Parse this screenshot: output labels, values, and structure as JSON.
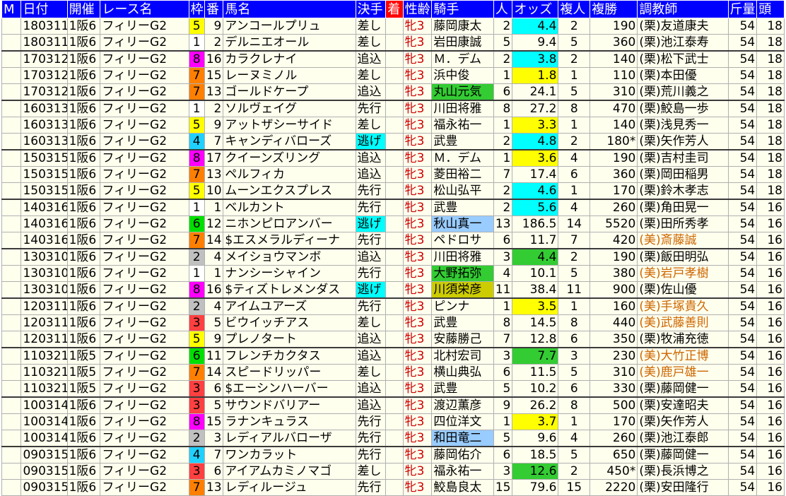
{
  "header": [
    "M",
    "日付",
    "開催",
    "レース名",
    "枠",
    "番",
    "馬名",
    "決手",
    "着",
    "性齢",
    "騎手",
    "人",
    "オッズ",
    "複人",
    "複勝",
    "調教師",
    "斤量",
    "頭"
  ],
  "colors": {
    "frame": {
      "1": "#ffffff",
      "2": "#c0c0c0",
      "3": "#ff4040",
      "4": "#20d0ff",
      "5": "#ffff00",
      "6": "#00e000",
      "7": "#ff8000",
      "8": "#ff00ff"
    },
    "odds_hl": {
      "y": "#ffff00",
      "c": "#00ffff",
      "g": "#33cc33"
    }
  },
  "rows": [
    {
      "date": "180311",
      "kaisai": "1阪6",
      "race": "フィリーG2",
      "waku": "5",
      "ban": "9",
      "horse": "アンコールプリュ",
      "kimete": "差し",
      "chaku": "",
      "sexage": "牝3",
      "jockey": "藤岡康太",
      "jhl": "",
      "ninki": "2",
      "odds": "4.4",
      "ohl": "c",
      "fninki": "2",
      "fuku": "190",
      "mark": "",
      "trainer": "(栗)友道康夫",
      "tm": "",
      "kinryo": "54",
      "tou": "18",
      "grp": false
    },
    {
      "date": "180311",
      "kaisai": "1阪6",
      "race": "フィリーG2",
      "waku": "1",
      "ban": "2",
      "horse": "デルニエオール",
      "kimete": "差し",
      "chaku": "",
      "sexage": "牝3",
      "jockey": "岩田康誠",
      "jhl": "",
      "ninki": "5",
      "odds": "9.4",
      "ohl": "",
      "fninki": "5",
      "fuku": "360",
      "mark": "",
      "trainer": "(栗)池江泰寿",
      "tm": "",
      "kinryo": "54",
      "tou": "18",
      "grp": false
    },
    {
      "date": "170312",
      "kaisai": "1阪6",
      "race": "フィリーG2",
      "waku": "8",
      "ban": "16",
      "horse": "カラクレナイ",
      "kimete": "追込",
      "chaku": "",
      "sexage": "牝3",
      "jockey": "Ｍ．デム",
      "jhl": "",
      "ninki": "2",
      "odds": "3.8",
      "ohl": "c",
      "fninki": "2",
      "fuku": "140",
      "mark": "",
      "trainer": "(栗)松下武士",
      "tm": "",
      "kinryo": "54",
      "tou": "18",
      "grp": true
    },
    {
      "date": "170312",
      "kaisai": "1阪6",
      "race": "フィリーG2",
      "waku": "7",
      "ban": "15",
      "horse": "レーヌミノル",
      "kimete": "差し",
      "chaku": "",
      "sexage": "牝3",
      "jockey": "浜中俊",
      "jhl": "",
      "ninki": "1",
      "odds": "1.8",
      "ohl": "y",
      "fninki": "1",
      "fuku": "110",
      "mark": "",
      "trainer": "(栗)本田優",
      "tm": "",
      "kinryo": "54",
      "tou": "18",
      "grp": false
    },
    {
      "date": "170312",
      "kaisai": "1阪6",
      "race": "フィリーG2",
      "waku": "7",
      "ban": "13",
      "horse": "ゴールドケープ",
      "kimete": "追込",
      "chaku": "",
      "sexage": "牝3",
      "jockey": "丸山元気",
      "jhl": "gr",
      "ninki": "6",
      "odds": "24.1",
      "ohl": "",
      "fninki": "5",
      "fuku": "310",
      "mark": "",
      "trainer": "(栗)荒川義之",
      "tm": "",
      "kinryo": "54",
      "tou": "18",
      "grp": false
    },
    {
      "date": "160313",
      "kaisai": "1阪6",
      "race": "フィリーG2",
      "waku": "1",
      "ban": "2",
      "horse": "ソルヴェイグ",
      "kimete": "先行",
      "chaku": "",
      "sexage": "牝3",
      "jockey": "川田将雅",
      "jhl": "",
      "ninki": "8",
      "odds": "27.2",
      "ohl": "",
      "fninki": "8",
      "fuku": "470",
      "mark": "",
      "trainer": "(栗)鮫島一歩",
      "tm": "",
      "kinryo": "54",
      "tou": "18",
      "grp": true
    },
    {
      "date": "160313",
      "kaisai": "1阪6",
      "race": "フィリーG2",
      "waku": "5",
      "ban": "9",
      "horse": "アットザシーサイド",
      "kimete": "差し",
      "chaku": "",
      "sexage": "牝3",
      "jockey": "福永祐一",
      "jhl": "",
      "ninki": "1",
      "odds": "3.3",
      "ohl": "y",
      "fninki": "1",
      "fuku": "140",
      "mark": "",
      "trainer": "(栗)浅見秀一",
      "tm": "",
      "kinryo": "54",
      "tou": "18",
      "grp": false
    },
    {
      "date": "160313",
      "kaisai": "1阪6",
      "race": "フィリーG2",
      "waku": "4",
      "ban": "7",
      "horse": "キャンディバローズ",
      "kimete": "逃げ",
      "chaku": "",
      "sexage": "牝3",
      "jockey": "武豊",
      "jhl": "",
      "ninki": "2",
      "odds": "4.8",
      "ohl": "c",
      "fninki": "2",
      "fuku": "180",
      "mark": "*",
      "trainer": "(栗)矢作芳人",
      "tm": "",
      "kinryo": "54",
      "tou": "18",
      "grp": false
    },
    {
      "date": "150315",
      "kaisai": "1阪6",
      "race": "フィリーG2",
      "waku": "8",
      "ban": "17",
      "horse": "クイーンズリング",
      "kimete": "追込",
      "chaku": "",
      "sexage": "牝3",
      "jockey": "Ｍ．デム",
      "jhl": "",
      "ninki": "1",
      "odds": "3.6",
      "ohl": "y",
      "fninki": "4",
      "fuku": "190",
      "mark": "",
      "trainer": "(栗)吉村圭司",
      "tm": "",
      "kinryo": "54",
      "tou": "18",
      "grp": true
    },
    {
      "date": "150315",
      "kaisai": "1阪6",
      "race": "フィリーG2",
      "waku": "7",
      "ban": "13",
      "horse": "ペルフィカ",
      "kimete": "追込",
      "chaku": "",
      "sexage": "牝3",
      "jockey": "菱田裕二",
      "jhl": "",
      "ninki": "7",
      "odds": "17.4",
      "ohl": "",
      "fninki": "6",
      "fuku": "360",
      "mark": "",
      "trainer": "(栗)岡田稲男",
      "tm": "",
      "kinryo": "54",
      "tou": "18",
      "grp": false
    },
    {
      "date": "150315",
      "kaisai": "1阪6",
      "race": "フィリーG2",
      "waku": "5",
      "ban": "10",
      "horse": "ムーンエクスプレス",
      "kimete": "先行",
      "chaku": "",
      "sexage": "牝3",
      "jockey": "松山弘平",
      "jhl": "",
      "ninki": "2",
      "odds": "4.6",
      "ohl": "c",
      "fninki": "1",
      "fuku": "170",
      "mark": "",
      "trainer": "(栗)鈴木孝志",
      "tm": "",
      "kinryo": "54",
      "tou": "18",
      "grp": false
    },
    {
      "date": "140316",
      "kaisai": "1阪6",
      "race": "フィリーG2",
      "waku": "1",
      "ban": "1",
      "horse": "ベルカント",
      "kimete": "先行",
      "chaku": "",
      "sexage": "牝3",
      "jockey": "武豊",
      "jhl": "",
      "ninki": "2",
      "odds": "5.6",
      "ohl": "c",
      "fninki": "4",
      "fuku": "260",
      "mark": "",
      "trainer": "(栗)角田晃一",
      "tm": "",
      "kinryo": "54",
      "tou": "16",
      "grp": true
    },
    {
      "date": "140316",
      "kaisai": "1阪6",
      "race": "フィリーG2",
      "waku": "6",
      "ban": "12",
      "horse": "ニホンピロアンバー",
      "kimete": "逃げ",
      "chaku": "",
      "sexage": "牝3",
      "jockey": "秋山真一",
      "jhl": "lb",
      "ninki": "13",
      "odds": "186.5",
      "ohl": "",
      "fninki": "14",
      "fuku": "5520",
      "mark": "",
      "trainer": "(栗)田所秀孝",
      "tm": "",
      "kinryo": "54",
      "tou": "16",
      "grp": false
    },
    {
      "date": "140316",
      "kaisai": "1阪6",
      "race": "フィリーG2",
      "waku": "7",
      "ban": "14",
      "horse": "$エスメラルディーナ",
      "kimete": "先行",
      "chaku": "",
      "sexage": "牝3",
      "jockey": "ペドロサ",
      "jhl": "",
      "ninki": "6",
      "odds": "11.7",
      "ohl": "",
      "fninki": "7",
      "fuku": "420",
      "mark": "",
      "trainer": "(美)斎藤誠",
      "tm": "mi",
      "kinryo": "54",
      "tou": "16",
      "grp": false
    },
    {
      "date": "130310",
      "kaisai": "1阪6",
      "race": "フィリーG2",
      "waku": "2",
      "ban": "4",
      "horse": "メイショウマンボ",
      "kimete": "追込",
      "chaku": "",
      "sexage": "牝3",
      "jockey": "川田将雅",
      "jhl": "",
      "ninki": "3",
      "odds": "4.4",
      "ohl": "g",
      "fninki": "2",
      "fuku": "190",
      "mark": "",
      "trainer": "(栗)飯田明弘",
      "tm": "",
      "kinryo": "54",
      "tou": "16",
      "grp": true
    },
    {
      "date": "130310",
      "kaisai": "1阪6",
      "race": "フィリーG2",
      "waku": "1",
      "ban": "1",
      "horse": "ナンシーシャイン",
      "kimete": "先行",
      "chaku": "",
      "sexage": "牝3",
      "jockey": "大野拓弥",
      "jhl": "gr",
      "ninki": "4",
      "odds": "10.1",
      "ohl": "",
      "fninki": "5",
      "fuku": "380",
      "mark": "",
      "trainer": "(美)岩戸孝樹",
      "tm": "mi",
      "kinryo": "54",
      "tou": "16",
      "grp": false
    },
    {
      "date": "130310",
      "kaisai": "1阪6",
      "race": "フィリーG2",
      "waku": "8",
      "ban": "16",
      "horse": "$ティズトレメンダス",
      "kimete": "逃げ",
      "chaku": "",
      "sexage": "牝3",
      "jockey": "川須栄彦",
      "jhl": "ol",
      "ninki": "11",
      "odds": "38.4",
      "ohl": "",
      "fninki": "11",
      "fuku": "900",
      "mark": "",
      "trainer": "(栗)佐山優",
      "tm": "",
      "kinryo": "54",
      "tou": "16",
      "grp": false
    },
    {
      "date": "120311",
      "kaisai": "1阪6",
      "race": "フィリーG2",
      "waku": "2",
      "ban": "4",
      "horse": "アイムユアーズ",
      "kimete": "先行",
      "chaku": "",
      "sexage": "牝3",
      "jockey": "ピンナ",
      "jhl": "",
      "ninki": "1",
      "odds": "3.5",
      "ohl": "y",
      "fninki": "1",
      "fuku": "160",
      "mark": "",
      "trainer": "(美)手塚貴久",
      "tm": "mi",
      "kinryo": "54",
      "tou": "16",
      "grp": true
    },
    {
      "date": "120311",
      "kaisai": "1阪6",
      "race": "フィリーG2",
      "waku": "3",
      "ban": "5",
      "horse": "ビウイッチアス",
      "kimete": "差し",
      "chaku": "",
      "sexage": "牝3",
      "jockey": "武豊",
      "jhl": "",
      "ninki": "8",
      "odds": "14.5",
      "ohl": "",
      "fninki": "8",
      "fuku": "440",
      "mark": "",
      "trainer": "(美)武藤善則",
      "tm": "mi",
      "kinryo": "54",
      "tou": "16",
      "grp": false
    },
    {
      "date": "120311",
      "kaisai": "1阪6",
      "race": "フィリーG2",
      "waku": "5",
      "ban": "9",
      "horse": "プレノタート",
      "kimete": "追込",
      "chaku": "",
      "sexage": "牝3",
      "jockey": "安藤勝己",
      "jhl": "",
      "ninki": "7",
      "odds": "12.8",
      "ohl": "",
      "fninki": "6",
      "fuku": "350",
      "mark": "",
      "trainer": "(栗)牧浦充徳",
      "tm": "",
      "kinryo": "54",
      "tou": "16",
      "grp": false
    },
    {
      "date": "110321",
      "kaisai": "1阪5",
      "race": "フィリーG2",
      "waku": "6",
      "ban": "11",
      "horse": "フレンチカクタス",
      "kimete": "追込",
      "chaku": "",
      "sexage": "牝3",
      "jockey": "北村宏司",
      "jhl": "",
      "ninki": "3",
      "odds": "7.7",
      "ohl": "g",
      "fninki": "3",
      "fuku": "230",
      "mark": "",
      "trainer": "(美)大竹正博",
      "tm": "mi",
      "kinryo": "54",
      "tou": "16",
      "grp": true
    },
    {
      "date": "110321",
      "kaisai": "1阪5",
      "race": "フィリーG2",
      "waku": "7",
      "ban": "14",
      "horse": "スピードリッパー",
      "kimete": "差し",
      "chaku": "",
      "sexage": "牝3",
      "jockey": "横山典弘",
      "jhl": "",
      "ninki": "6",
      "odds": "11.5",
      "ohl": "",
      "fninki": "5",
      "fuku": "310",
      "mark": "",
      "trainer": "(美)鹿戸雄一",
      "tm": "mi",
      "kinryo": "54",
      "tou": "16",
      "grp": false
    },
    {
      "date": "110321",
      "kaisai": "1阪5",
      "race": "フィリーG2",
      "waku": "3",
      "ban": "6",
      "horse": "$エーシンハーバー",
      "kimete": "追込",
      "chaku": "",
      "sexage": "牝3",
      "jockey": "武豊",
      "jhl": "",
      "ninki": "5",
      "odds": "10.2",
      "ohl": "",
      "fninki": "6",
      "fuku": "330",
      "mark": "",
      "trainer": "(栗)藤岡健一",
      "tm": "",
      "kinryo": "54",
      "tou": "16",
      "grp": false
    },
    {
      "date": "100314",
      "kaisai": "1阪6",
      "race": "フィリーG2",
      "waku": "3",
      "ban": "5",
      "horse": "サウンドバリアー",
      "kimete": "追込",
      "chaku": "",
      "sexage": "牝3",
      "jockey": "渡辺薫彦",
      "jhl": "",
      "ninki": "9",
      "odds": "26.2",
      "ohl": "",
      "fninki": "8",
      "fuku": "500",
      "mark": "",
      "trainer": "(栗)安達昭夫",
      "tm": "",
      "kinryo": "54",
      "tou": "16",
      "grp": true
    },
    {
      "date": "100314",
      "kaisai": "1阪6",
      "race": "フィリーG2",
      "waku": "8",
      "ban": "15",
      "horse": "ラナンキュラス",
      "kimete": "先行",
      "chaku": "",
      "sexage": "牝3",
      "jockey": "四位洋文",
      "jhl": "",
      "ninki": "1",
      "odds": "3.7",
      "ohl": "y",
      "fninki": "1",
      "fuku": "170",
      "mark": "",
      "trainer": "(栗)矢作芳人",
      "tm": "",
      "kinryo": "54",
      "tou": "16",
      "grp": false
    },
    {
      "date": "100314",
      "kaisai": "1阪6",
      "race": "フィリーG2",
      "waku": "2",
      "ban": "3",
      "horse": "レディアルバローザ",
      "kimete": "先行",
      "chaku": "",
      "sexage": "牝3",
      "jockey": "和田竜二",
      "jhl": "lb",
      "ninki": "5",
      "odds": "9.6",
      "ohl": "",
      "fninki": "4",
      "fuku": "260",
      "mark": "",
      "trainer": "(栗)池江泰郎",
      "tm": "",
      "kinryo": "54",
      "tou": "16",
      "grp": false
    },
    {
      "date": "090315",
      "kaisai": "1阪6",
      "race": "フィリーG2",
      "waku": "4",
      "ban": "7",
      "horse": "ワンカラット",
      "kimete": "先行",
      "chaku": "",
      "sexage": "牝3",
      "jockey": "藤岡佑介",
      "jhl": "",
      "ninki": "6",
      "odds": "18.5",
      "ohl": "",
      "fninki": "5",
      "fuku": "650",
      "mark": "",
      "trainer": "(栗)藤岡健一",
      "tm": "",
      "kinryo": "54",
      "tou": "16",
      "grp": true
    },
    {
      "date": "090315",
      "kaisai": "1阪6",
      "race": "フィリーG2",
      "waku": "3",
      "ban": "6",
      "horse": "アイアムカミノマゴ",
      "kimete": "差し",
      "chaku": "",
      "sexage": "牝3",
      "jockey": "福永祐一",
      "jhl": "",
      "ninki": "3",
      "odds": "12.6",
      "ohl": "g",
      "fninki": "2",
      "fuku": "450",
      "mark": "*",
      "trainer": "(栗)長浜博之",
      "tm": "",
      "kinryo": "54",
      "tou": "16",
      "grp": false
    },
    {
      "date": "090315",
      "kaisai": "1阪6",
      "race": "フィリーG2",
      "waku": "7",
      "ban": "13",
      "horse": "レディルージュ",
      "kimete": "先行",
      "chaku": "",
      "sexage": "牝3",
      "jockey": "鮫島良太",
      "jhl": "",
      "ninki": "15",
      "odds": "79.6",
      "ohl": "",
      "fninki": "15",
      "fuku": "2220",
      "mark": "",
      "trainer": "(栗)安田隆行",
      "tm": "",
      "kinryo": "54",
      "tou": "16",
      "grp": false
    }
  ]
}
